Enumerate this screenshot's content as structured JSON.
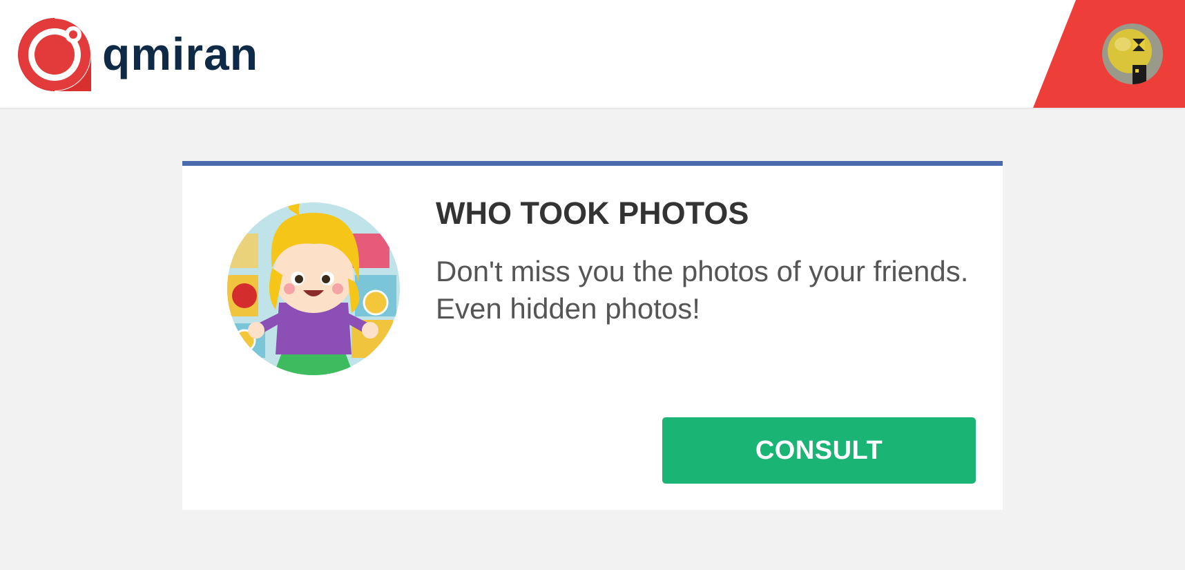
{
  "header": {
    "brand_name": "qmiran",
    "icons": {
      "logo": "qmiran-logo-icon",
      "avatar": "user-avatar"
    },
    "colors": {
      "brand_red": "#e03a3a",
      "brand_text": "#0e2a47"
    }
  },
  "card": {
    "title": "WHO TOOK PHOTOS",
    "description": "Don't miss you the photos of your friends. Even hidden photos!",
    "button_label": "CONSULT",
    "colors": {
      "top_border": "#4a6cae",
      "button": "#1ab574"
    }
  }
}
